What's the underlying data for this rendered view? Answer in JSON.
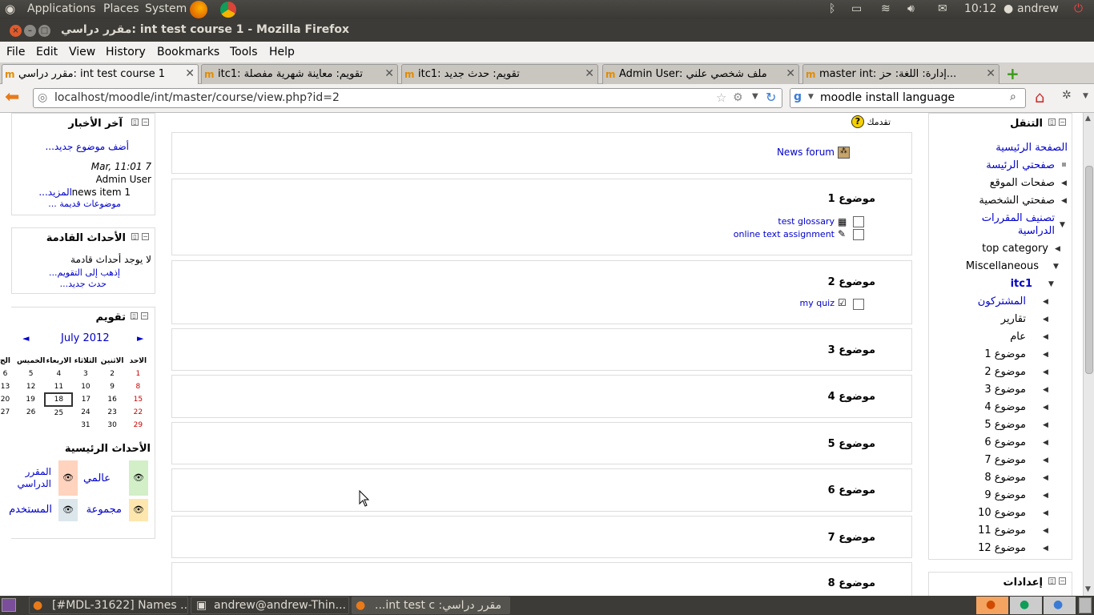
{
  "topbar": {
    "applications": "Applications",
    "places": "Places",
    "system": "System",
    "time": "10:12",
    "user": "andrew"
  },
  "window": {
    "title": "مقرر دراسي: int test course 1 - Mozilla Firefox"
  },
  "menu": {
    "file": "File",
    "edit": "Edit",
    "view": "View",
    "history": "History",
    "bookmarks": "Bookmarks",
    "tools": "Tools",
    "help": "Help"
  },
  "tabs": [
    {
      "label": "مقرر دراسي: int test course 1"
    },
    {
      "label": "itc1: تقويم: معاينة شهرية مفصلة"
    },
    {
      "label": "itc1: تقويم: حدث جديد"
    },
    {
      "label": "Admin User: ملف شخصي علني"
    },
    {
      "label": "master int: إدارة: اللغة: حز..."
    }
  ],
  "url": "localhost/moodle/int/master/course/view.php?id=2",
  "search": "moodle install language",
  "news_block": {
    "title": "آخر الأخبار",
    "add_topic": "أضف موضوع جديد...",
    "date": "7 Mar, 11:01",
    "author": "Admin User",
    "item": "news item 1",
    "more": "المزيد...",
    "older": "موضوعات قديمة ..."
  },
  "upcoming_block": {
    "title": "الأحداث القادمة",
    "none": "لا يوجد أحداث قادمة",
    "goto_calendar": "إذهب إلى التقويم...",
    "new_event": "حدث جديد..."
  },
  "calendar_block": {
    "title": "تقويم",
    "month": "July 2012",
    "prev": "◄",
    "next": "►",
    "days": [
      "الاحد",
      "الاثنين",
      "الثلاثاء",
      "الاربعاء",
      "الخميس",
      "الج"
    ],
    "weeks": [
      [
        "1",
        "2",
        "3",
        "4",
        "5",
        "6"
      ],
      [
        "8",
        "9",
        "10",
        "11",
        "12",
        "13"
      ],
      [
        "15",
        "16",
        "17",
        "18",
        "19",
        "20"
      ],
      [
        "22",
        "23",
        "24",
        "25",
        "26",
        "27"
      ],
      [
        "29",
        "30",
        "31",
        "",
        "",
        ""
      ]
    ],
    "key_title": "الأحداث الرئيسية",
    "key_global": "عالمي",
    "key_course": "المقرر الدراسي",
    "key_group": "مجموعة",
    "key_user": "المستخدم"
  },
  "course": {
    "progress": "تقدمك",
    "news_forum": "News forum",
    "sections": [
      {
        "title": "موضوع 1",
        "items": [
          "test glossary",
          "online text assignment"
        ]
      },
      {
        "title": "موضوع 2",
        "items": [
          "my quiz"
        ]
      },
      {
        "title": "موضوع 3"
      },
      {
        "title": "موضوع 4"
      },
      {
        "title": "موضوع 5"
      },
      {
        "title": "موضوع 6"
      },
      {
        "title": "موضوع 7"
      },
      {
        "title": "موضوع 8"
      }
    ]
  },
  "nav_block": {
    "title": "التنقل",
    "home": "الصفحة الرئيسية",
    "myhome": "صفحتي الرئيسة",
    "site_pages": "صفحات الموقع",
    "my_profile": "صفحتي الشخصية",
    "courses": "تصنيف المقررات الدراسية",
    "top_category": "top category",
    "misc": "Miscellaneous",
    "itc1": "itc1",
    "participants": "المشتركون",
    "reports": "تقارير",
    "general": "عام",
    "topics": [
      "موضوع 1",
      "موضوع 2",
      "موضوع 3",
      "موضوع 4",
      "موضوع 5",
      "موضوع 6",
      "موضوع 7",
      "موضوع 8",
      "موضوع 9",
      "موضوع 10",
      "موضوع 11",
      "موضوع 12"
    ]
  },
  "settings_block": {
    "title": "إعدادات"
  },
  "taskbar": {
    "t1": "[#MDL-31622] Names ...",
    "t2": "andrew@andrew-Thin...",
    "t3": "مقرر دراسي: int test c..."
  }
}
